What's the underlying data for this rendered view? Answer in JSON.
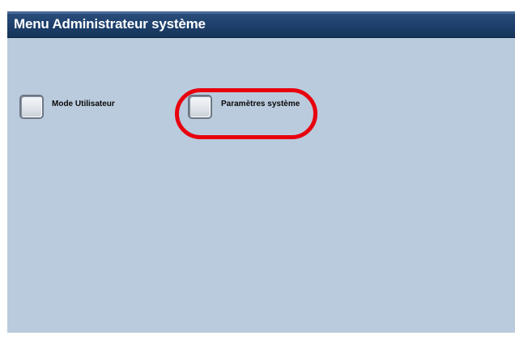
{
  "window": {
    "title": "Menu Administrateur système"
  },
  "menu": {
    "options": [
      {
        "label": "Mode Utilisateur",
        "icon": "checkbox-icon",
        "checked": false
      },
      {
        "label": "Paramètres système",
        "icon": "checkbox-icon",
        "checked": false,
        "highlighted": true
      }
    ]
  },
  "colors": {
    "title_bar": "#1d3f6b",
    "background": "#b9cbdd",
    "highlight": "#e8000d"
  }
}
